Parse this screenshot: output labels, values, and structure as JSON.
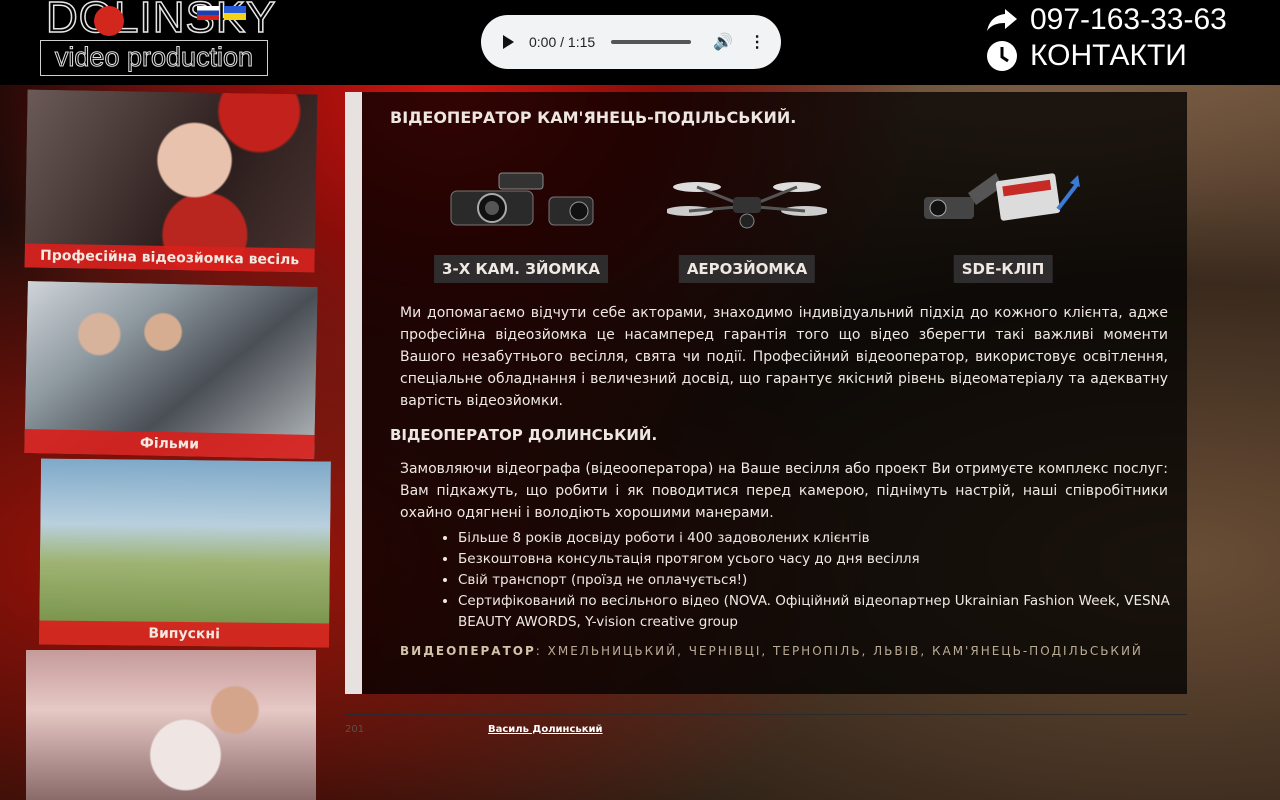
{
  "logo": {
    "word": "DOLINSKY",
    "subtitle": "video production"
  },
  "audio": {
    "time": "0:00 / 1:15"
  },
  "contacts": {
    "phone": "097-163-33-63",
    "contacts_label": "КОНТАКТИ"
  },
  "gallery": [
    {
      "caption": "Професійна відеозйомка весіль"
    },
    {
      "caption": "Фільми"
    },
    {
      "caption": "Випускні"
    }
  ],
  "main": {
    "title": "ВІДЕОПЕРАТОР КАМ'ЯНЕЦЬ-ПОДІЛЬСЬКИЙ.",
    "services": [
      {
        "label": "3-Х КАМ. ЗЙОМКА",
        "icon": "video-camera-icon"
      },
      {
        "label": "АЕРОЗЙОМКА",
        "icon": "drone-icon"
      },
      {
        "label": "SDE-КЛІП",
        "icon": "clip-editing-icon"
      }
    ],
    "paragraph1": "Ми допомагаємо відчути себе акторами, знаходимо індивідуальний підхід до кожного клієнта, адже професійна відеозйомка це насамперед гарантія того що відео зберегти такі важливі моменти Вашого незабутнього весілля, свята чи події. Професійний відеооператор, використовує освітлення, спеціальне обладнання і величезний досвід, що гарантує якісний рівень відеоматеріалу та адекватну вартість відеозйомки.",
    "subtitle": "ВІДЕОПЕРАТОР ДОЛИНСЬКИЙ.",
    "paragraph2": "Замовляючи відеографа (відеооператора) на Ваше весілля або проект Ви отримуєте комплекс послуг: Вам підкажуть, що робити і як поводитися перед камерою, піднімуть настрій, наші співробітники охайно одягнені і володіють хорошими манерами.",
    "bullets": [
      "Більше 8 років досвіду роботи і 400 задоволених клієнтів",
      "Безкоштовна консультація протягом усього часу до дня весілля",
      "Свій транспорт (проїзд не оплачується!)",
      "Сертифікований по весільного відео (NOVA. Офіційний відеопартнер Ukrainian Fashion Week, VESNA BEAUTY AWORDS, Y-vision creative group"
    ],
    "cities_label": "ВИДЕОПЕРАТОР",
    "cities": ": ХМЕЛЬНИЦЬКИЙ, ЧЕРНІВЦІ, ТЕРНОПІЛЬ, ЛЬВІВ, КАМ'ЯНЕЦЬ-ПОДІЛЬСЬКИЙ"
  },
  "footer": {
    "year": "201",
    "author_link": "Василь Долинський"
  },
  "colors": {
    "accent_red": "#d8201c",
    "panel_bg": "rgba(0,0,0,0.76)",
    "topbar": "#000000"
  }
}
